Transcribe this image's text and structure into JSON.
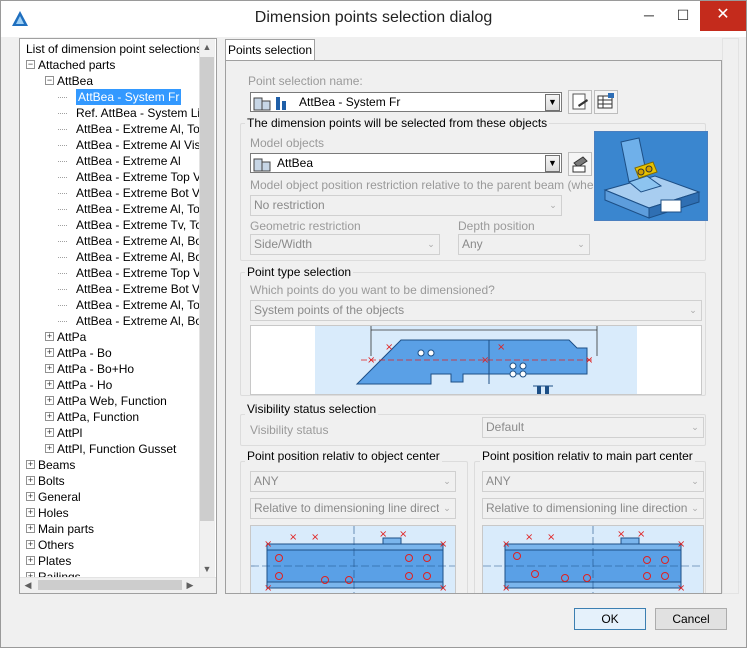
{
  "window": {
    "title": "Dimension points selection dialog",
    "minimize_glyph": "─",
    "maximize_glyph": "☐",
    "close_glyph": "✕"
  },
  "tree": {
    "root_label": "List of dimension point selections",
    "items": [
      {
        "label": "Attached parts",
        "level": 1,
        "expander": "−"
      },
      {
        "label": "AttBea",
        "level": 2,
        "expander": "−"
      },
      {
        "label": "AttBea - System Fr",
        "level": 3,
        "selected": true
      },
      {
        "label": "Ref. AttBea - System Li",
        "level": 3
      },
      {
        "label": "AttBea - Extreme Al, Top",
        "level": 3
      },
      {
        "label": "AttBea - Extreme Al Vis",
        "level": 3
      },
      {
        "label": "AttBea - Extreme Al",
        "level": 3
      },
      {
        "label": "AttBea - Extreme Top Vis",
        "level": 3
      },
      {
        "label": "AttBea - Extreme Bot Vis",
        "level": 3
      },
      {
        "label": "AttBea - Extreme Al, Top",
        "level": 3
      },
      {
        "label": "AttBea - Extreme Tv, Top",
        "level": 3
      },
      {
        "label": "AttBea - Extreme Al, Bot",
        "level": 3
      },
      {
        "label": "AttBea - Extreme Al, Bot",
        "level": 3
      },
      {
        "label": "AttBea - Extreme Top Vis",
        "level": 3
      },
      {
        "label": "AttBea - Extreme Bot Vis",
        "level": 3
      },
      {
        "label": "AttBea - Extreme Al, Top",
        "level": 3
      },
      {
        "label": "AttBea - Extreme Al, Bot",
        "level": 3
      },
      {
        "label": "AttPa",
        "level": 2,
        "expander": "+"
      },
      {
        "label": "AttPa - Bo",
        "level": 2,
        "expander": "+"
      },
      {
        "label": "AttPa - Bo+Ho",
        "level": 2,
        "expander": "+"
      },
      {
        "label": "AttPa - Ho",
        "level": 2,
        "expander": "+"
      },
      {
        "label": "AttPa Web, Function",
        "level": 2,
        "expander": "+"
      },
      {
        "label": "AttPa, Function",
        "level": 2,
        "expander": "+"
      },
      {
        "label": "AttPl",
        "level": 2,
        "expander": "+"
      },
      {
        "label": "AttPl, Function Gusset",
        "level": 2,
        "expander": "+"
      },
      {
        "label": "Beams",
        "level": 1,
        "expander": "+"
      },
      {
        "label": "Bolts",
        "level": 1,
        "expander": "+"
      },
      {
        "label": "General",
        "level": 1,
        "expander": "+"
      },
      {
        "label": "Holes",
        "level": 1,
        "expander": "+"
      },
      {
        "label": "Main parts",
        "level": 1,
        "expander": "+"
      },
      {
        "label": "Others",
        "level": 1,
        "expander": "+"
      },
      {
        "label": "Plates",
        "level": 1,
        "expander": "+"
      },
      {
        "label": "Railings",
        "level": 1,
        "expander": "+"
      }
    ]
  },
  "tab": {
    "label": "Points selection"
  },
  "points_selection": {
    "name_label": "Point selection name:",
    "name_value": "AttBea - System Fr",
    "objects_group_title": "The dimension points will be selected from these objects",
    "model_objects_label": "Model objects",
    "model_objects_value": "AttBea",
    "restriction_label": "Model object position restriction relative to the parent beam (when",
    "restriction_value": "No restriction",
    "geometric_label": "Geometric restriction",
    "geometric_value": "Side/Width",
    "depth_label": "Depth position",
    "depth_value": "Any"
  },
  "point_type": {
    "group_title": "Point type selection",
    "question": "Which points do you want to be dimensioned?",
    "value": "System points of the objects"
  },
  "visibility": {
    "group_title": "Visibility status selection",
    "label": "Visibility status",
    "value": "Default"
  },
  "object_center": {
    "group_title": "Point position relativ to object center",
    "value1": "ANY",
    "value2": "Relative to dimensioning line direction"
  },
  "main_part_center": {
    "group_title": "Point position relativ to main part center",
    "value1": "ANY",
    "value2": "Relative to dimensioning line direction"
  },
  "buttons": {
    "ok": "OK",
    "cancel": "Cancel"
  },
  "colors": {
    "selection": "#3399ff",
    "close": "#c42b1c",
    "steel_blue": "#4d94d6",
    "marker_red": "#e02020"
  }
}
